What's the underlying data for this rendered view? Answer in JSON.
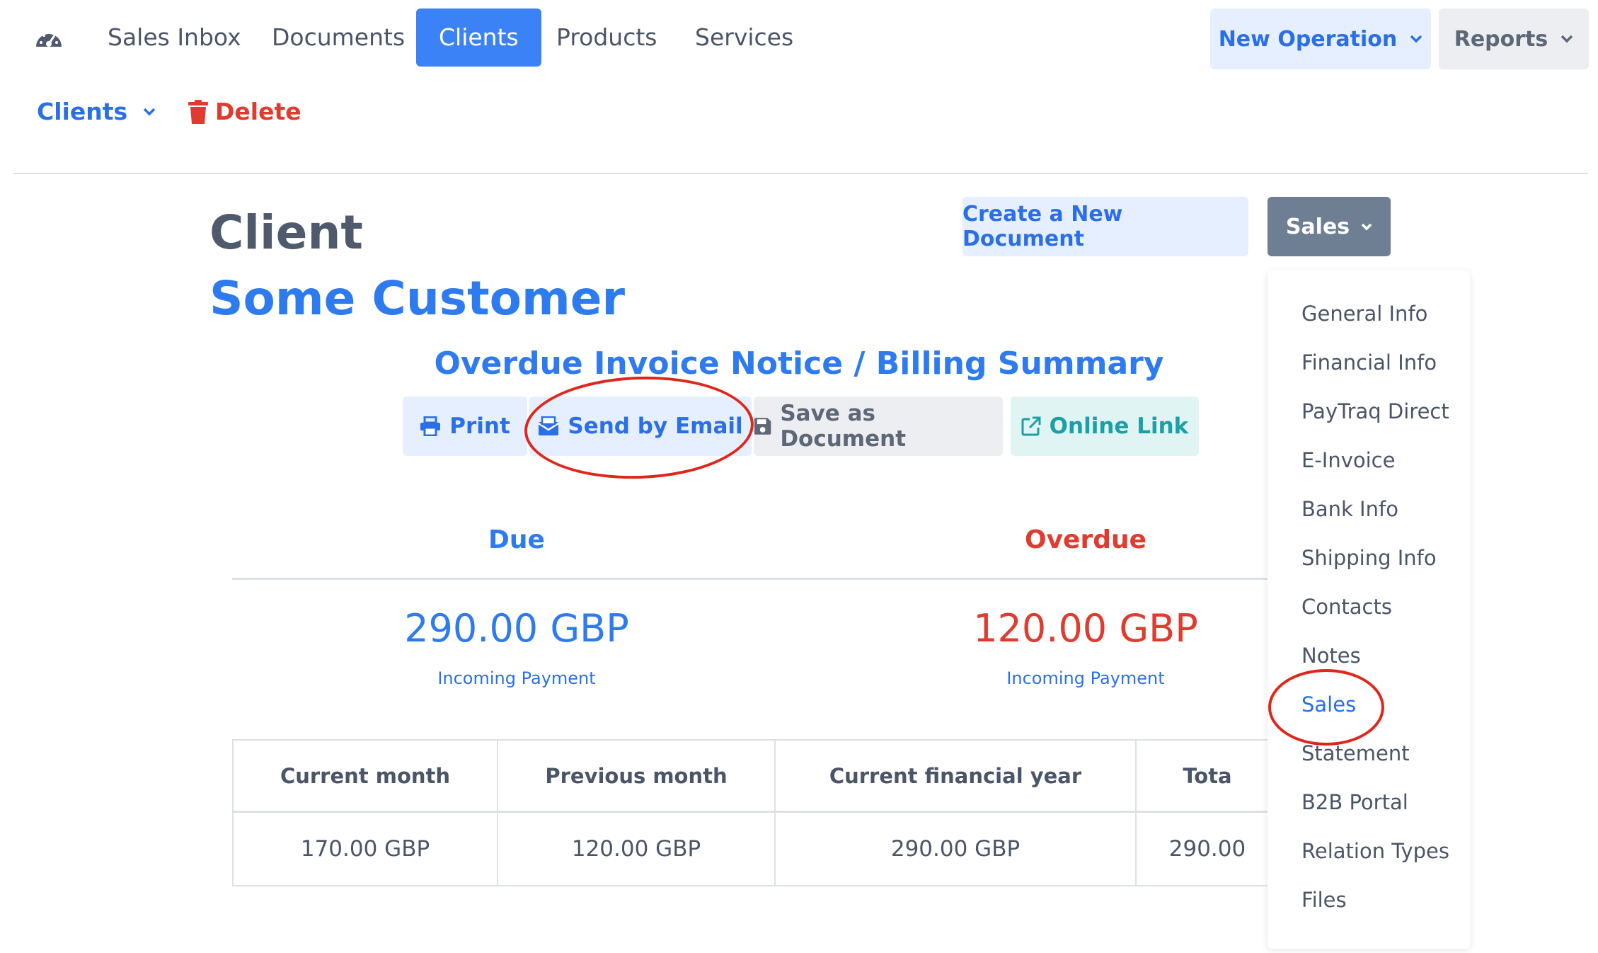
{
  "nav": {
    "items": [
      {
        "label": "Sales Inbox",
        "active": false
      },
      {
        "label": "Documents",
        "active": false
      },
      {
        "label": "Clients",
        "active": true
      },
      {
        "label": "Products",
        "active": false
      },
      {
        "label": "Services",
        "active": false
      }
    ],
    "new_operation": "New Operation",
    "reports": "Reports"
  },
  "subnav": {
    "clients": "Clients",
    "delete": "Delete"
  },
  "header": {
    "label": "Client",
    "name": "Some Customer",
    "create_button": "Create a New Document",
    "sales_button": "Sales"
  },
  "summary": {
    "title": "Overdue Invoice Notice / Billing Summary",
    "actions": {
      "print": "Print",
      "email": "Send by Email",
      "save": "Save as Document",
      "link": "Online Link"
    },
    "due": {
      "heading": "Due",
      "amount": "290.00 GBP",
      "sub": "Incoming Payment"
    },
    "overdue": {
      "heading": "Overdue",
      "amount": "120.00 GBP",
      "sub": "Incoming Payment"
    }
  },
  "table": {
    "headers": [
      "Current month",
      "Previous month",
      "Current financial year",
      "Tota"
    ],
    "row": [
      "170.00 GBP",
      "120.00 GBP",
      "290.00 GBP",
      "290.00"
    ]
  },
  "dropdown": {
    "items": [
      {
        "label": "General Info"
      },
      {
        "label": "Financial Info"
      },
      {
        "label": "PayTraq Direct"
      },
      {
        "label": "E-Invoice"
      },
      {
        "label": "Bank Info"
      },
      {
        "label": "Shipping Info"
      },
      {
        "label": "Contacts"
      },
      {
        "label": "Notes"
      },
      {
        "label": "Sales",
        "active": true
      },
      {
        "label": "Statement"
      },
      {
        "label": "B2B Portal"
      },
      {
        "label": "Relation Types"
      },
      {
        "label": "Files"
      }
    ]
  },
  "colors": {
    "primary": "#3b82f6",
    "link_blue": "#2e7bf0",
    "danger": "#e03b2e",
    "teal": "#1aa0a5",
    "annotation_red": "#e0251b"
  },
  "icons": [
    "dashboard-icon",
    "chevron-down-icon",
    "trash-icon",
    "print-icon",
    "envelope-icon",
    "save-icon",
    "external-link-icon"
  ]
}
